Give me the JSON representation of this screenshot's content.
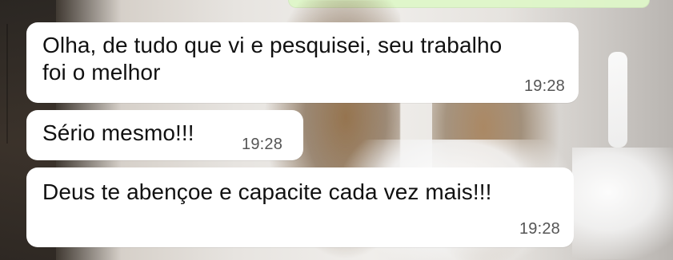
{
  "chat": {
    "messages": [
      {
        "text": "Olha, de tudo que vi e pesquisei, seu trabalho\nfoi o melhor",
        "time": "19:28"
      },
      {
        "text": "Sério mesmo!!!",
        "time": "19:28"
      },
      {
        "text": "Deus te abençoe e capacite cada vez mais!!!",
        "time": "19:28"
      }
    ]
  },
  "colors": {
    "bubble": "#ffffff",
    "text": "#111111",
    "time": "#555555",
    "outgoing_tint": "#dff7c9"
  }
}
